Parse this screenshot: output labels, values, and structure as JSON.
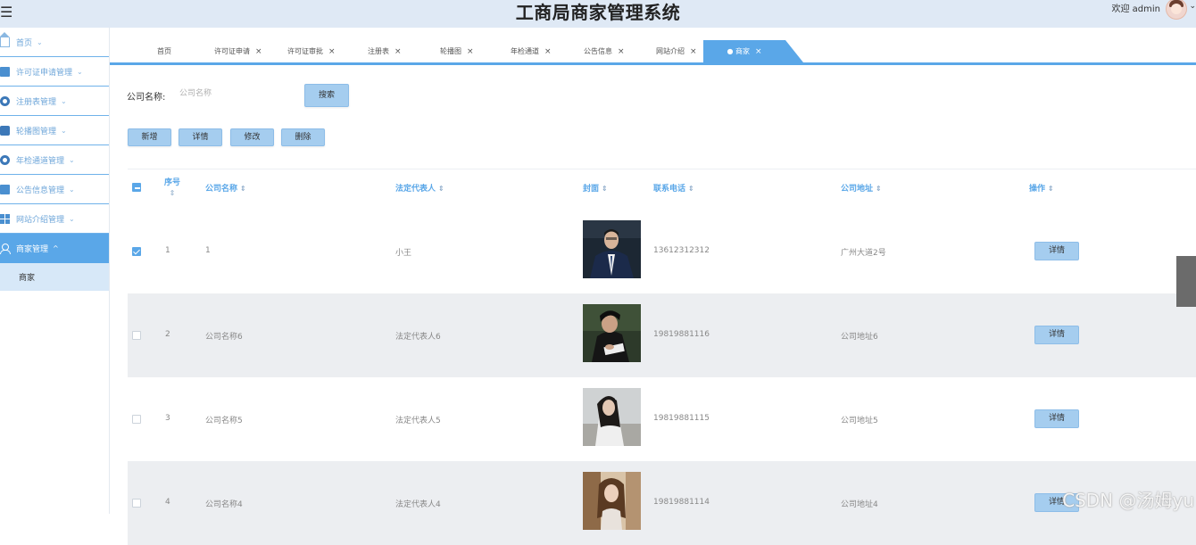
{
  "header": {
    "title": "工商局商家管理系统",
    "welcome": "欢迎 admin",
    "menu_icon": "hamburger-icon",
    "user_chevron": "⌄"
  },
  "sidebar": {
    "items": [
      {
        "label": "首页",
        "icon": "home-icon",
        "caret": "⌄"
      },
      {
        "label": "许可证申请管理",
        "icon": "document-icon",
        "caret": "⌄"
      },
      {
        "label": "注册表管理",
        "icon": "circle-icon",
        "caret": "⌄"
      },
      {
        "label": "轮播图管理",
        "icon": "bag-icon",
        "caret": "⌄"
      },
      {
        "label": "年检通道管理",
        "icon": "circle-icon",
        "caret": "⌄"
      },
      {
        "label": "公告信息管理",
        "icon": "notice-icon",
        "caret": "⌄"
      },
      {
        "label": "网站介绍管理",
        "icon": "grid-icon",
        "caret": "⌄"
      },
      {
        "label": "商家管理",
        "icon": "user-icon",
        "caret": "^",
        "active": true
      }
    ],
    "submenu": {
      "label": "商家"
    }
  },
  "tabs": [
    {
      "label": "首页",
      "closable": false
    },
    {
      "label": "许可证申请",
      "closable": true
    },
    {
      "label": "许可证审批",
      "closable": true
    },
    {
      "label": "注册表",
      "closable": true
    },
    {
      "label": "轮播图",
      "closable": true
    },
    {
      "label": "年检通道",
      "closable": true
    },
    {
      "label": "公告信息",
      "closable": true
    },
    {
      "label": "网站介绍",
      "closable": true
    },
    {
      "label": "● 商家",
      "closable": true,
      "active": true
    }
  ],
  "tab_close": "×",
  "search": {
    "label": "公司名称:",
    "placeholder": "公司名称",
    "button": "搜索"
  },
  "toolbar": {
    "add": "新增",
    "detail": "详情",
    "edit": "修改",
    "delete": "删除"
  },
  "table": {
    "headers": {
      "index": "序号",
      "company": "公司名称",
      "legal_rep": "法定代表人",
      "cover": "封面",
      "phone": "联系电话",
      "address": "公司地址",
      "action": "操作"
    },
    "sort_icon": "⇕",
    "rows": [
      {
        "index": "1",
        "company": "1",
        "legal_rep": "小王",
        "phone": "13612312312",
        "address": "广州大道2号",
        "action": "详情",
        "checked": true
      },
      {
        "index": "2",
        "company": "公司名称6",
        "legal_rep": "法定代表人6",
        "phone": "19819881116",
        "address": "公司地址6",
        "action": "详情",
        "checked": false
      },
      {
        "index": "3",
        "company": "公司名称5",
        "legal_rep": "法定代表人5",
        "phone": "19819881115",
        "address": "公司地址5",
        "action": "详情",
        "checked": false
      },
      {
        "index": "4",
        "company": "公司名称4",
        "legal_rep": "法定代表人4",
        "phone": "19819881114",
        "address": "公司地址4",
        "action": "详情",
        "checked": false
      }
    ]
  },
  "watermark": "CSDN @汤姆yu",
  "colors": {
    "primary": "#5aa7e8",
    "button": "#a5cdef",
    "header_bg": "#dfe9f5",
    "row_alt": "#eceef1"
  }
}
